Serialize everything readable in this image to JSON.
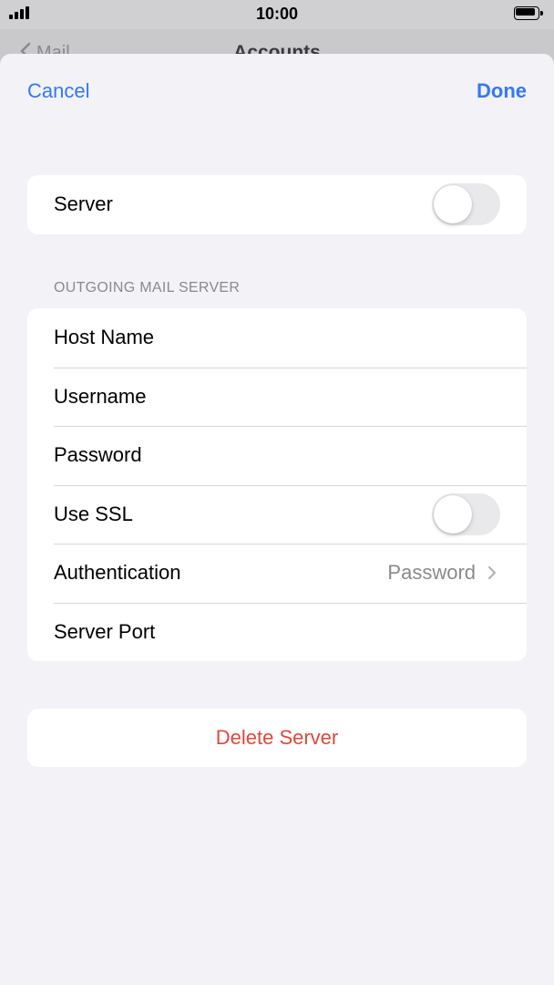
{
  "status_bar": {
    "time": "10:00"
  },
  "background_page": {
    "back_label": "Mail",
    "title": "Accounts"
  },
  "sheet": {
    "cancel_label": "Cancel",
    "done_label": "Done",
    "server_row": {
      "label": "Server",
      "toggle_on": false
    },
    "outgoing_section": {
      "header": "OUTGOING MAIL SERVER",
      "rows": {
        "host_name": "Host Name",
        "username": "Username",
        "password": "Password",
        "use_ssl": "Use SSL",
        "use_ssl_on": false,
        "authentication": "Authentication",
        "authentication_value": "Password",
        "server_port": "Server Port"
      }
    },
    "delete_label": "Delete Server"
  },
  "colors": {
    "accent": "#3478f6",
    "destructive": "#e0483a",
    "secondary_text": "#8a8a8e",
    "sheet_background": "#f2f2f7",
    "toggle_off": "#e9e9eb"
  },
  "icons": [
    "signal-icon",
    "battery-icon",
    "back-chevron-icon",
    "chevron-right-icon"
  ]
}
